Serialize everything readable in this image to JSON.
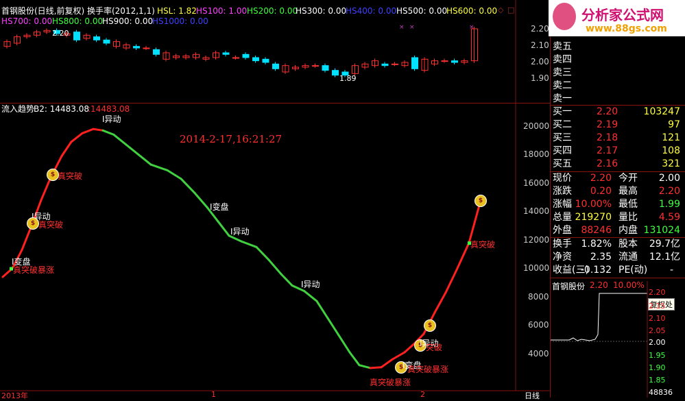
{
  "logo": {
    "title": "分析家公式网",
    "url": "www.88gs.com"
  },
  "kline_header": {
    "title": "首钢股份(日线,前复权) 换手率(2012,1,1)",
    "hsl": "HSL: 1.82",
    "hs100": "HS100: 1.00",
    "hs200": "HS200: 0.00",
    "hs300": "HS300: 0.00",
    "hs400": "HS400: 0.00",
    "hs500": "HS500: 0.00",
    "hs600": "HS600: 0.00",
    "hs700": "HS700: 0.00",
    "hs800": "HS800: 0.00",
    "hs900": "HS900: 0.00",
    "hs1000": "HS1000: 0.00",
    "colors": {
      "hsl": "#ffff40",
      "hs100": "#ff40ff",
      "hs200": "#40ff40",
      "hs300": "#ffffff",
      "hs400": "#4040ff",
      "hs500": "#ffffff",
      "hs600": "#ffff40",
      "hs700": "#ff40ff",
      "hs800": "#40ff40",
      "hs900": "#ffffff",
      "hs1000": "#4040ff"
    }
  },
  "kline_axis": [
    "2.20",
    "2.10",
    "2.00",
    "1.90"
  ],
  "kline_marks": {
    "high": "2.20",
    "low": "1.89"
  },
  "candles": [
    {
      "o": 2.09,
      "c": 2.12
    },
    {
      "o": 2.11,
      "c": 2.15
    },
    {
      "o": 2.15,
      "c": 2.16
    },
    {
      "o": 2.16,
      "c": 2.18
    },
    {
      "o": 2.18,
      "c": 2.19
    },
    {
      "o": 2.19,
      "c": 2.17
    },
    {
      "o": 2.16,
      "c": 2.17
    },
    {
      "o": 2.18,
      "c": 2.13
    },
    {
      "o": 2.14,
      "c": 2.16
    },
    {
      "o": 2.15,
      "c": 2.13
    },
    {
      "o": 2.13,
      "c": 2.11
    },
    {
      "o": 2.09,
      "c": 2.12
    },
    {
      "o": 2.08,
      "c": 2.1
    },
    {
      "o": 2.09,
      "c": 2.08
    },
    {
      "o": 2.08,
      "c": 2.08
    },
    {
      "o": 2.07,
      "c": 2.04
    },
    {
      "o": 2.01,
      "c": 2.05
    },
    {
      "o": 2.02,
      "c": 2.03
    },
    {
      "o": 2.02,
      "c": 2.03
    },
    {
      "o": 2.02,
      "c": 2.04
    },
    {
      "o": 2.01,
      "c": 2.02
    },
    {
      "o": 2.02,
      "c": 2.05
    },
    {
      "o": 2.05,
      "c": 2.04
    },
    {
      "o": 2.02,
      "c": 2.02
    },
    {
      "o": 2.04,
      "c": 2.02
    },
    {
      "o": 2.02,
      "c": 2.0
    },
    {
      "o": 2.01,
      "c": 1.99
    },
    {
      "o": 1.98,
      "c": 1.95
    },
    {
      "o": 1.93,
      "c": 1.97
    },
    {
      "o": 1.95,
      "c": 1.96
    },
    {
      "o": 1.96,
      "c": 1.97
    },
    {
      "o": 1.97,
      "c": 1.97
    },
    {
      "o": 1.97,
      "c": 1.94
    },
    {
      "o": 1.94,
      "c": 1.91
    },
    {
      "o": 1.93,
      "c": 1.91
    },
    {
      "o": 1.92,
      "c": 1.97
    },
    {
      "o": 1.96,
      "c": 1.98
    },
    {
      "o": 1.97,
      "c": 2.0
    },
    {
      "o": 1.98,
      "c": 1.97
    },
    {
      "o": 1.98,
      "c": 1.98
    },
    {
      "o": 1.97,
      "c": 1.99
    },
    {
      "o": 2.02,
      "c": 1.95
    },
    {
      "o": 1.94,
      "c": 2.01
    },
    {
      "o": 1.98,
      "c": 2.0
    },
    {
      "o": 2.0,
      "c": 2.0
    },
    {
      "o": 2.0,
      "c": 1.99
    },
    {
      "o": 1.99,
      "c": 2.0
    },
    {
      "o": 2.0,
      "c": 2.2
    }
  ],
  "flow_header": {
    "title": "流入趋势",
    "b2": "B2: 14483.08",
    "val": ":14483.08"
  },
  "flow_axis": [
    "20000",
    "18000",
    "16000",
    "14000",
    "12000",
    "10000",
    "8000",
    "6000",
    "4000"
  ],
  "date_stamp": "2014-2-17,16:21:27",
  "flow_labels": {
    "yidong_top": "I异动",
    "zhentupo1": "真突破",
    "yidong1": "I异动",
    "zhentupo2": "真突破",
    "bianpan1": "I变盘",
    "baozhang1": "真突破暴涨",
    "bianpan2": "I变盘",
    "yidong2": "I异动",
    "yidong3": "I异动",
    "bianpan3": "I变盘",
    "baozhang2": "真突破暴涨",
    "baozhang3": "真突破暴涨",
    "yidong4": "I异动",
    "zhentupo3": "突破",
    "zhentupo4": "真突破"
  },
  "bottom_axis": {
    "year": "2013年",
    "mark1": "1",
    "mark2": "2",
    "period": "日线"
  },
  "order_book": {
    "sell": [
      {
        "label": "卖五"
      },
      {
        "label": "卖四"
      },
      {
        "label": "卖三"
      },
      {
        "label": "卖二"
      },
      {
        "label": "卖一"
      }
    ],
    "buy": [
      {
        "label": "买一",
        "price": "2.20",
        "vol": "103247"
      },
      {
        "label": "买二",
        "price": "2.19",
        "vol": "97"
      },
      {
        "label": "买三",
        "price": "2.18",
        "vol": "121"
      },
      {
        "label": "买四",
        "price": "2.17",
        "vol": "108"
      },
      {
        "label": "买五",
        "price": "2.16",
        "vol": "321"
      }
    ]
  },
  "stats": {
    "xianjia_l": "现价",
    "xianjia_v": "2.20",
    "jinkai_l": "今开",
    "jinkai_v": "2.00",
    "zhangdie_l": "涨跌",
    "zhangdie_v": "0.20",
    "zuigao_l": "最高",
    "zuigao_v": "2.20",
    "zhangfu_l": "涨幅",
    "zhangfu_v": "10.00%",
    "zuidi_l": "最低",
    "zuidi_v": "1.99",
    "zongliang_l": "总量",
    "zongliang_v": "219270",
    "liangbi_l": "量比",
    "liangbi_v": "4.59",
    "waipan_l": "外盘",
    "waipan_v": "88246",
    "neipan_l": "内盘",
    "neipan_v": "131024",
    "huanshou_l": "换手",
    "huanshou_v": "1.82%",
    "guben_l": "股本",
    "guben_v": "29.7亿",
    "jingzi_l": "净资",
    "jingzi_v": "2.35",
    "liutong_l": "流通",
    "liutong_v": "12.1亿",
    "shouyi_l": "收益(三)",
    "shouyi_v": "-0.132",
    "pe_l": "PE(动)",
    "pe_v": "-"
  },
  "mini_chart": {
    "title": "首钢股份",
    "price": "2.20",
    "pct": "10.00%",
    "tooltip": "复权处",
    "axis": [
      "2.20",
      "2.15",
      "2.10",
      "2.05",
      "2.00",
      "1.95",
      "1.90",
      "1.85"
    ],
    "bottom": "48836"
  }
}
